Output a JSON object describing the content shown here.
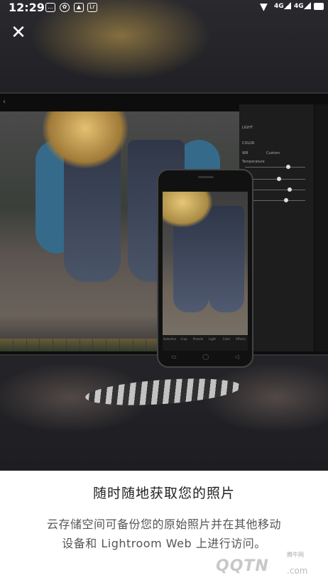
{
  "status_bar": {
    "time": "12:29",
    "notification_icons": [
      "chat-icon",
      "flower-icon",
      "image-icon",
      "lightroom-icon"
    ],
    "lightroom_label": "Lr",
    "network_label_1": "4G",
    "network_label_2": "4G"
  },
  "close_button": {
    "icon": "close-icon",
    "glyph": "✕"
  },
  "tablet_ui": {
    "panel_labels": {
      "light": "LIGHT",
      "color": "COLOR",
      "wb": "WB",
      "wb_value": "Custom",
      "temperature": "Temperature"
    }
  },
  "phone_ui": {
    "tool_labels": [
      "Selective",
      "Crop",
      "Presets",
      "Light",
      "Color",
      "Effects"
    ]
  },
  "caption": {
    "title": "随时随地获取您的照片",
    "body": "云存储空间可备份您的原始照片并在其他移动设备和 Lightroom Web 上进行访问。"
  },
  "watermark": {
    "site": "腾牛网",
    "logo": "QQTN",
    "domain": ".com"
  }
}
